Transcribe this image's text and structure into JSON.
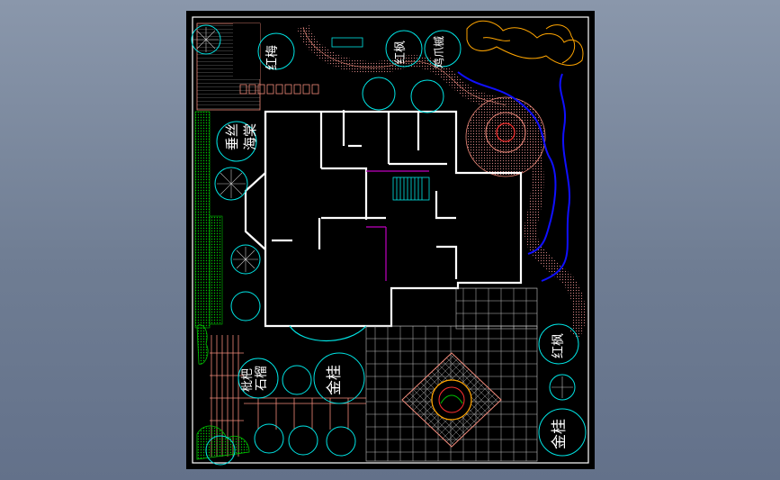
{
  "window": {
    "background_color": "#77849b",
    "viewport_color": "#000000"
  },
  "plan_labels": {
    "top_left_tree": "红梅",
    "top_center_tree_a": "红枫",
    "top_center_tree_b": "鸡爪槭",
    "left_tree_a": "垂丝",
    "left_tree_b": "海棠",
    "bottom_left_tree_a": "石榴",
    "bottom_left_tree_b": "枇杷",
    "bottom_tree_center": "金桂",
    "right_tree_top": "红枫",
    "right_tree_bottom": "金桂"
  },
  "colors": {
    "wall": "#ffffff",
    "paving": "#f08a7a",
    "tree_outline": "#00e5e5",
    "water_edge": "#1010ff",
    "rockery": "#ffa500",
    "shrub": "#00c000",
    "glass": "#c000c0",
    "path_dots": "#d08080"
  }
}
